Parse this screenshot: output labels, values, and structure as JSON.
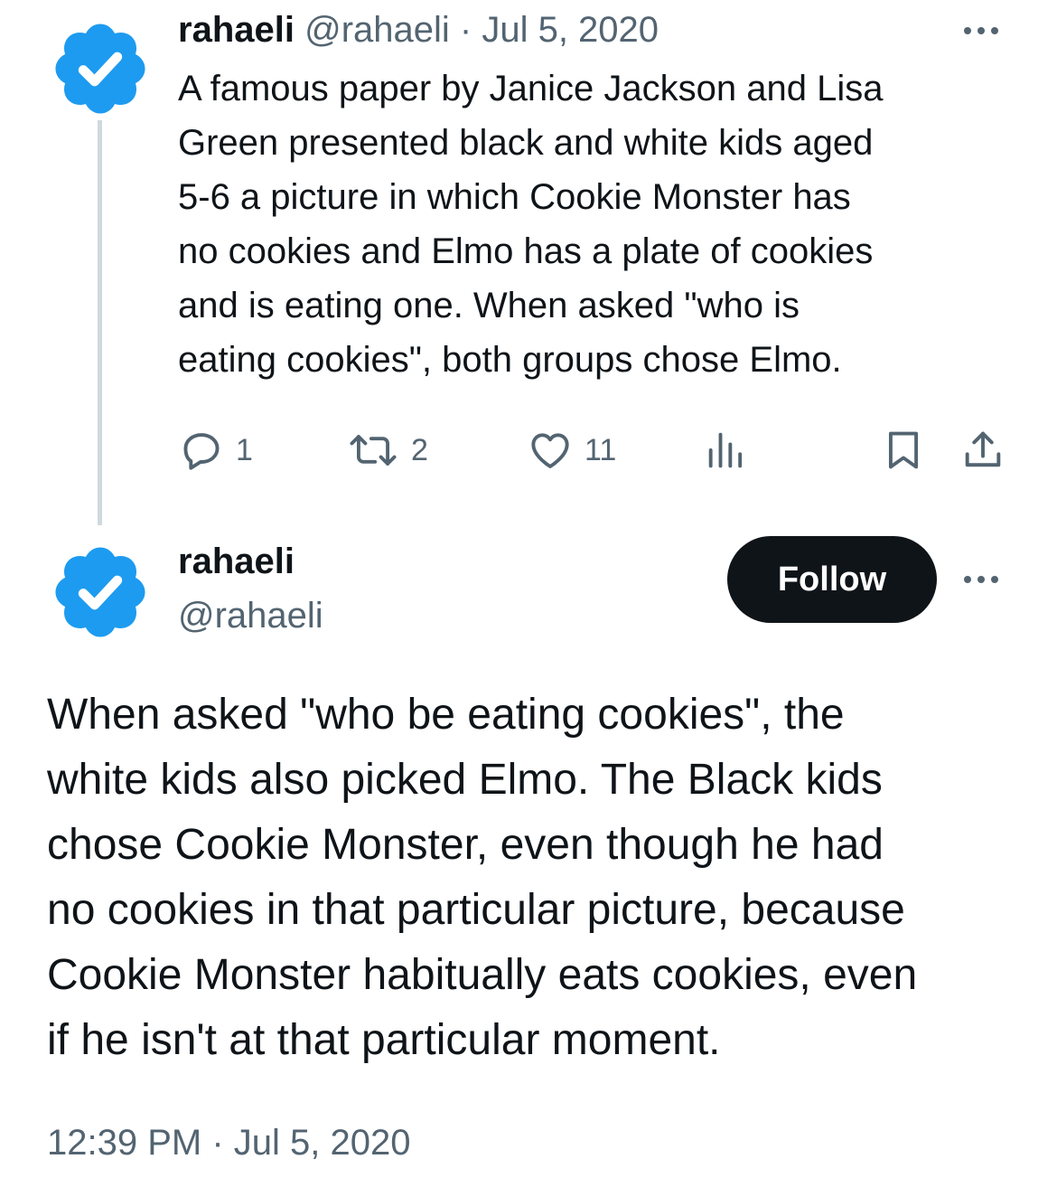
{
  "reply_tweet": {
    "display_name": "rahaeli",
    "handle": "@rahaeli",
    "separator": " · ",
    "date": "Jul 5, 2020",
    "body": "A famous paper by Janice Jackson and Lisa\nGreen presented black and white kids aged\n5-6 a picture in which Cookie Monster has\nno cookies and Elmo has a plate of cookies\nand is eating one. When asked \"who is\neating cookies\", both groups chose Elmo.",
    "actions": {
      "replies": "1",
      "retweets": "2",
      "likes": "11"
    }
  },
  "main_tweet": {
    "display_name": "rahaeli",
    "handle": "@rahaeli",
    "follow_label": "Follow",
    "body": "When asked \"who be eating cookies\", the\nwhite kids also picked Elmo. The Black kids\nchose Cookie Monster, even though he had\nno cookies in that particular picture, because\nCookie Monster habitually eats cookies, even\nif he isn't at that particular moment.",
    "timestamp": "12:39 PM · Jul 5, 2020"
  },
  "colors": {
    "verified_blue": "#1d9bf0",
    "text_primary": "#0f1419",
    "text_muted": "#536471",
    "thread_line": "#cfd9de",
    "follow_bg": "#0f1419"
  },
  "icons": {
    "verified": "verified-badge-icon",
    "more": "more-dots-icon",
    "reply": "reply-bubble-icon",
    "retweet": "retweet-icon",
    "like": "heart-icon",
    "views": "views-bar-chart-icon",
    "bookmark": "bookmark-icon",
    "share": "share-upload-icon"
  }
}
